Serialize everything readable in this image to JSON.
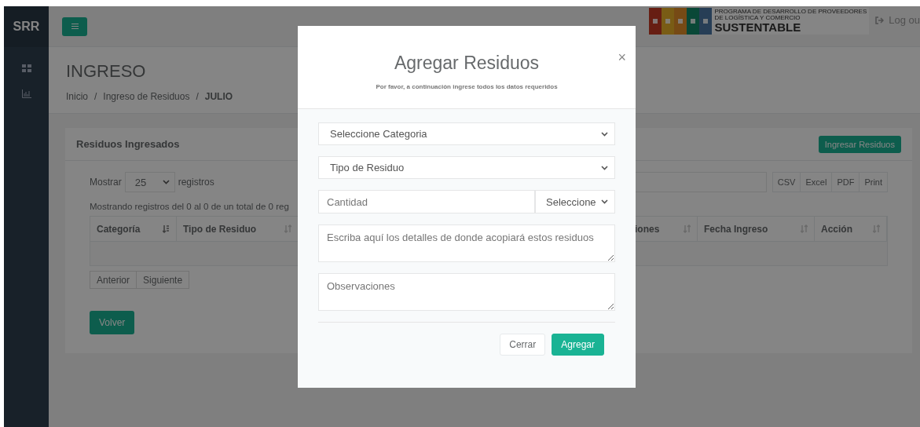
{
  "sidebar": {
    "brand": "SRR"
  },
  "topbar": {
    "logo": {
      "line_1": "PROGRAMA DE DESARROLLO DE PROVEEDORES",
      "line_2": "DE LOGÍSTICA Y COMERCIO",
      "line_3": "SUSTENTABLE"
    },
    "logout": "Log ou"
  },
  "page": {
    "title": "INGRESO",
    "breadcrumb": [
      {
        "label": "Inicio",
        "separator": "/",
        "current": false
      },
      {
        "label": "Ingreso de Residuos",
        "separator": "/",
        "current": false
      },
      {
        "label": "JULIO",
        "current": true
      }
    ]
  },
  "panel": {
    "title": "Residuos Ingresados",
    "add_button": "Ingresar Residuos",
    "length": {
      "prefix": "Mostrar",
      "value": "25",
      "suffix": "registros"
    },
    "export_buttons": [
      "CSV",
      "Excel",
      "PDF",
      "Print"
    ],
    "info": "Mostrando registros del 0 al 0 de un total de 0 reg",
    "columns": [
      {
        "label": "Categoría",
        "sorted": true
      },
      {
        "label": "Tipo de Residuo",
        "sorted": false
      },
      {
        "label": "iones",
        "sorted": false
      },
      {
        "label": "Fecha Ingreso",
        "sorted": false
      },
      {
        "label": "Acción",
        "sorted": false
      }
    ],
    "pagination": [
      "Anterior",
      "Siguiente"
    ],
    "back_button": "Volver"
  },
  "dialog": {
    "title": "Agregar Residuos",
    "subtitle": "Por favor, a continuación ingrese todos los datos requeridos",
    "close": "×",
    "fields": [
      {
        "kind": "select",
        "value": "Seleccione Categoria"
      },
      {
        "kind": "select",
        "value": "Tipo de Residuo"
      },
      {
        "kind": "input_group",
        "placeholder": "Cantidad",
        "unit": "Seleccione"
      },
      {
        "kind": "textarea",
        "placeholder": "Escriba aquí los detalles de donde acopiará estos residuos"
      },
      {
        "kind": "textarea",
        "placeholder": "Observaciones"
      }
    ],
    "buttons": [
      {
        "label": "Cerrar",
        "kind": "secondary"
      },
      {
        "label": "Agregar",
        "kind": "primary"
      }
    ]
  }
}
